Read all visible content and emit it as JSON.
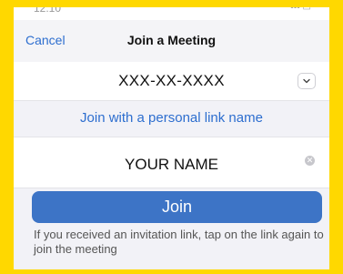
{
  "statusbar": {
    "time": "12:10",
    "indicators": "••• ▭"
  },
  "navbar": {
    "cancel_label": "Cancel",
    "title": "Join a Meeting"
  },
  "meeting_id": {
    "value": "XXX-XX-XXXX",
    "dropdown_icon": "chevron-down-icon"
  },
  "personal_link": {
    "label": "Join with a personal link name"
  },
  "name_field": {
    "value": "YOUR NAME",
    "clear_icon": "clear-icon"
  },
  "join_button": {
    "label": "Join"
  },
  "hint": {
    "text": "If you received an invitation link, tap on the link again to join the meeting"
  },
  "colors": {
    "accent": "#2d6ecf",
    "button": "#3d74c6",
    "frame": "#ffd800"
  }
}
